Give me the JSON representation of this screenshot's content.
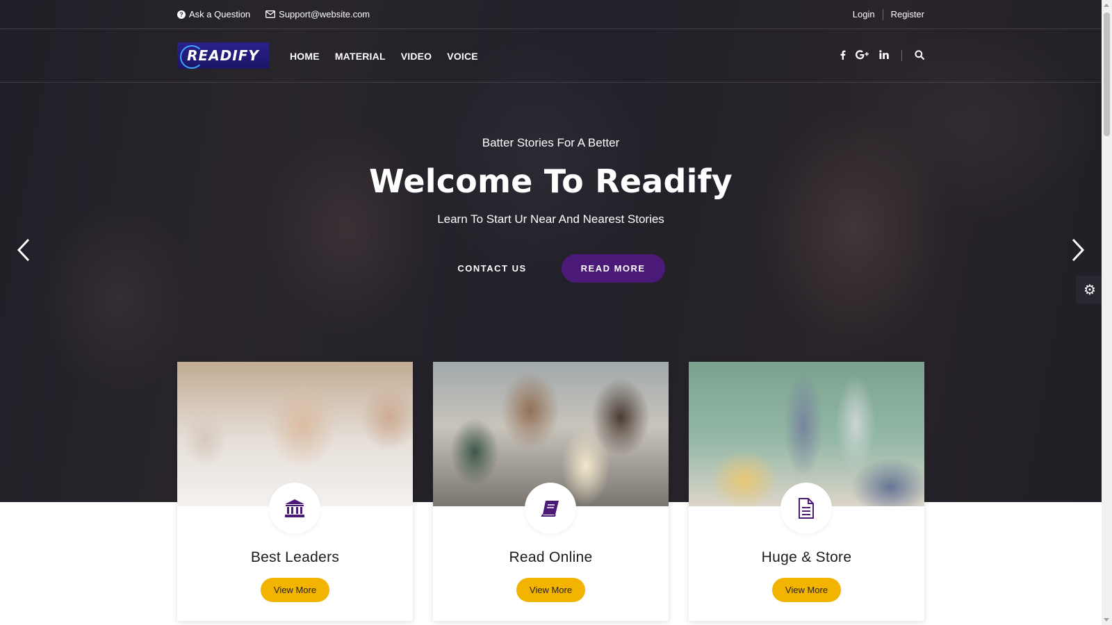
{
  "topbar": {
    "ask_label": "Ask a Question",
    "email_label": "Support@website.com",
    "login_label": "Login",
    "register_label": "Register"
  },
  "brand": {
    "logo_text": "READIFY"
  },
  "nav": {
    "items": [
      {
        "label": "HOME"
      },
      {
        "label": "MATERIAL"
      },
      {
        "label": "VIDEO"
      },
      {
        "label": "VOICE"
      }
    ]
  },
  "hero": {
    "pretitle": "Batter Stories For A Better",
    "title": "Welcome To Readify",
    "subtitle": "Learn To Start Ur Near And Nearest Stories",
    "contact_label": "CONTACT US",
    "readmore_label": "READ MORE"
  },
  "cards": [
    {
      "title": "Best Leaders",
      "button": "View More",
      "icon": "bank-icon"
    },
    {
      "title": "Read Online",
      "button": "View More",
      "icon": "book-icon"
    },
    {
      "title": "Huge & Store",
      "button": "View More",
      "icon": "document-icon"
    }
  ],
  "colors": {
    "accent_purple": "#4b1a78",
    "button_yellow": "#f2b400"
  }
}
